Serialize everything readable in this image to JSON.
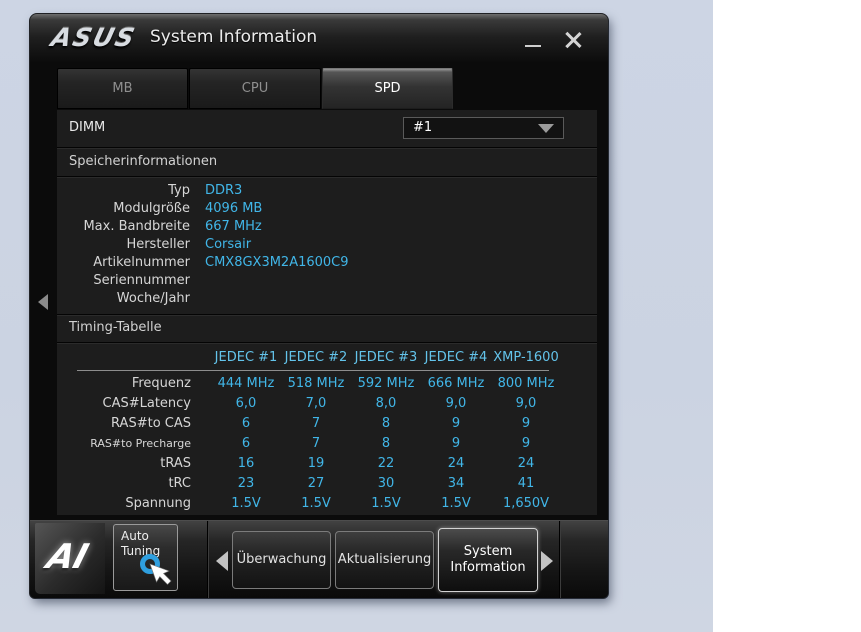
{
  "window": {
    "brand": "ASUS",
    "title": "System Information"
  },
  "tabs": [
    {
      "label": "MB"
    },
    {
      "label": "CPU"
    },
    {
      "label": "SPD"
    }
  ],
  "active_tab": "SPD",
  "dimm": {
    "label": "DIMM",
    "selected_option": "#1"
  },
  "memory_info": {
    "section_title": "Speicherinformationen",
    "rows": [
      {
        "label": "Typ",
        "value": "DDR3"
      },
      {
        "label": "Modulgröße",
        "value": "4096 MB"
      },
      {
        "label": "Max. Bandbreite",
        "value": "667 MHz"
      },
      {
        "label": "Hersteller",
        "value": "Corsair"
      },
      {
        "label": "Artikelnummer",
        "value": "CMX8GX3M2A1600C9"
      },
      {
        "label": "Seriennummer",
        "value": ""
      },
      {
        "label": "Woche/Jahr",
        "value": ""
      }
    ]
  },
  "timing_table": {
    "section_title": "Timing-Tabelle",
    "columns": [
      "JEDEC #1",
      "JEDEC #2",
      "JEDEC #3",
      "JEDEC #4",
      "XMP-1600"
    ],
    "rows": [
      {
        "label": "Frequenz",
        "values": [
          "444 MHz",
          "518 MHz",
          "592 MHz",
          "666 MHz",
          "800 MHz"
        ]
      },
      {
        "label": "CAS#Latency",
        "values": [
          "6,0",
          "7,0",
          "8,0",
          "9,0",
          "9,0"
        ]
      },
      {
        "label": "RAS#to CAS",
        "values": [
          "6",
          "7",
          "8",
          "9",
          "9"
        ]
      },
      {
        "label": "RAS#to Precharge",
        "values": [
          "6",
          "7",
          "8",
          "9",
          "9"
        ]
      },
      {
        "label": "tRAS",
        "values": [
          "16",
          "19",
          "22",
          "24",
          "24"
        ]
      },
      {
        "label": "tRC",
        "values": [
          "23",
          "27",
          "30",
          "34",
          "41"
        ]
      },
      {
        "label": "Spannung",
        "values": [
          "1.5V",
          "1.5V",
          "1.5V",
          "1.5V",
          "1,650V"
        ]
      }
    ]
  },
  "dock": {
    "logo_text": "AI",
    "auto_tuning_label": "Auto Tuning",
    "apps": [
      "Überwachung",
      "Aktualisierung",
      "System Information"
    ],
    "active_app": "System Information"
  },
  "colors": {
    "value_cyan": "#41b6e8",
    "header_cyan": "#63c3ea",
    "desktop_bg": "#cdd5e4"
  }
}
